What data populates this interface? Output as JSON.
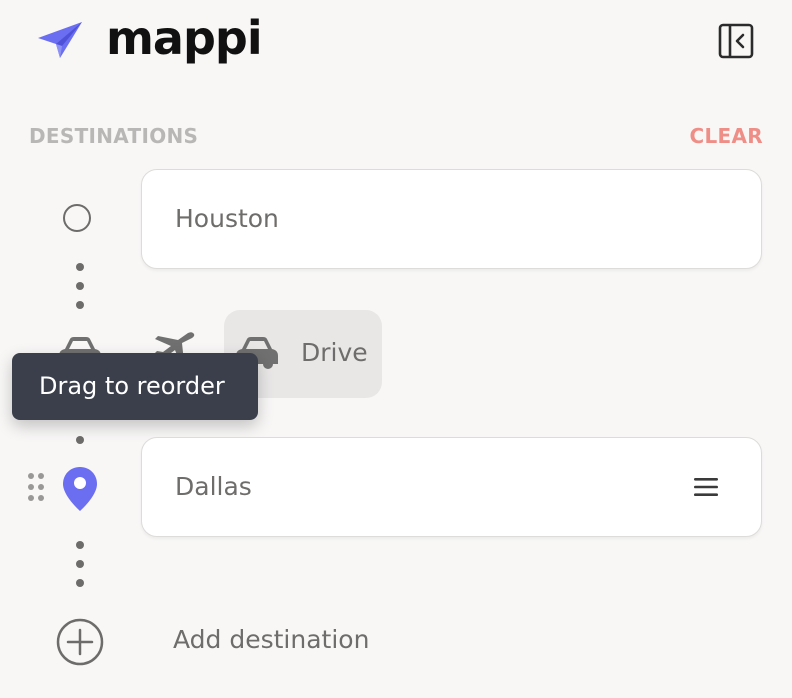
{
  "app": {
    "name": "mappi"
  },
  "colors": {
    "brand": "#6b6ef0",
    "clear": "#ef8e87",
    "tooltip_bg": "#3a3f4b"
  },
  "header": {
    "logo_icon": "paper-plane-icon",
    "collapse_icon": "sidebar-collapse-icon"
  },
  "destinations": {
    "section_label": "DESTINATIONS",
    "clear_label": "CLEAR",
    "items": [
      {
        "name": "Houston",
        "marker_icon": "circle-outline-icon"
      },
      {
        "name": "Dallas",
        "marker_icon": "map-pin-icon",
        "menu_icon": "hamburger-menu-icon"
      }
    ],
    "add_label": "Add destination"
  },
  "travel_mode": {
    "options": [
      "car-icon",
      "plane-icon",
      "car-icon"
    ],
    "selected_label": "Drive"
  },
  "tooltip": {
    "text": "Drag to reorder"
  }
}
